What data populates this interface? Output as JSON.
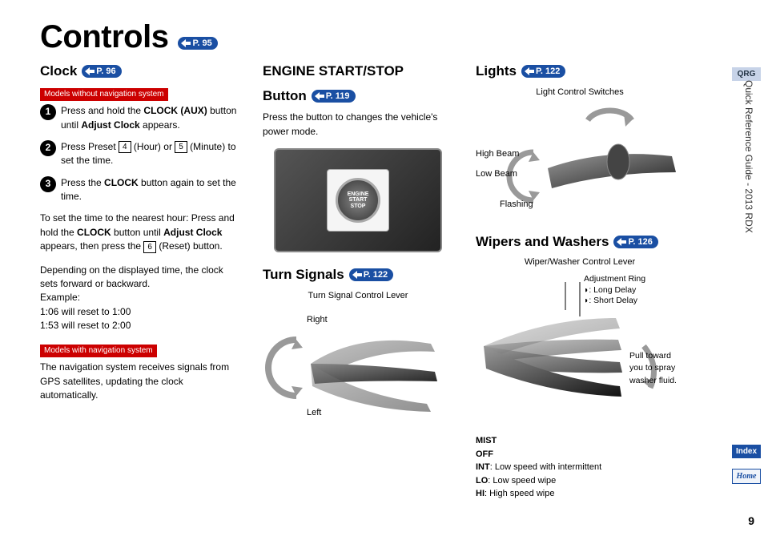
{
  "title": "Controls",
  "title_pill": "P. 95",
  "page_number": "9",
  "sidebar": {
    "qrg": "QRG",
    "vert": "Quick Reference Guide - 2013 RDX",
    "index": "Index",
    "home": "Home"
  },
  "clock": {
    "heading": "Clock",
    "pill": "P. 96",
    "label_no_nav": "Models without navigation system",
    "step1a": "Press and hold the ",
    "step1b": "CLOCK (AUX)",
    "step1c": " button until ",
    "step1d": "Adjust Clock",
    "step1e": " appears.",
    "step2a": "Press Preset ",
    "step2_k4": "4",
    "step2b": " (Hour) or ",
    "step2_k5": "5",
    "step2c": " (Minute) to set the time.",
    "step3a": "Press the ",
    "step3b": "CLOCK",
    "step3c": " button again to set the time.",
    "para1a": "To set the time to the nearest hour: Press and hold the ",
    "para1b": "CLOCK",
    "para1c": " button until ",
    "para1d": "Adjust Clock",
    "para1e": " appears, then press the ",
    "para1_k6": "6",
    "para1f": " (Reset) button.",
    "para2": "Depending on the displayed time, the clock sets forward or backward.",
    "para2_ex": "Example:",
    "para2_l1": "1:06 will reset to 1:00",
    "para2_l2": "1:53 will reset to 2:00",
    "label_nav": "Models with navigation system",
    "para3": "The navigation system receives signals from GPS satellites, updating the clock automatically."
  },
  "engine": {
    "heading1": "ENGINE START/STOP",
    "heading2": "Button",
    "pill": "P. 119",
    "text": "Press the button to changes the vehicle's power mode.",
    "btn_text": "ENGINE\nSTART\nSTOP"
  },
  "turn": {
    "heading": "Turn Signals",
    "pill": "P. 122",
    "caption": "Turn Signal Control Lever",
    "right": "Right",
    "left": "Left"
  },
  "lights": {
    "heading": "Lights",
    "pill": "P. 122",
    "caption": "Light Control Switches",
    "high": "High Beam",
    "low": "Low Beam",
    "flash": "Flashing"
  },
  "wipers": {
    "heading": "Wipers and Washers",
    "pill": "P. 126",
    "caption": "Wiper/Washer Control Lever",
    "ring": "Adjustment Ring",
    "ring_long": ": Long Delay",
    "ring_short": ": Short Delay",
    "pull": "Pull toward you to spray washer fluid.",
    "mist": "MIST",
    "off": "OFF",
    "int_b": "INT",
    "int": ": Low speed with intermittent",
    "lo_b": "LO",
    "lo": ": Low speed wipe",
    "hi_b": "HI",
    "hi": ": High speed wipe"
  }
}
